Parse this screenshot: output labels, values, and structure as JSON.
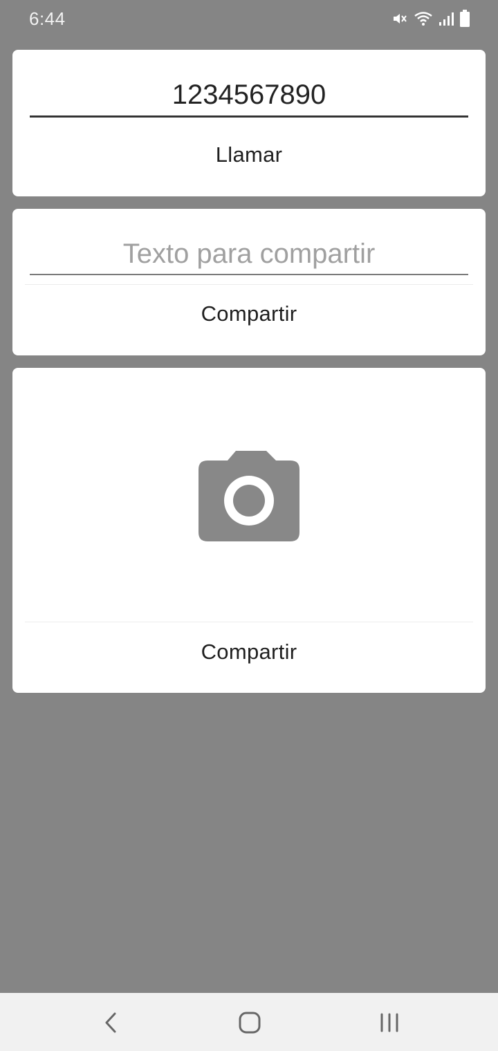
{
  "status_bar": {
    "time": "6:44",
    "icons": [
      "mute-icon",
      "wifi-icon",
      "signal-icon",
      "battery-icon"
    ]
  },
  "call_card": {
    "phone_value": "1234567890",
    "call_label": "Llamar"
  },
  "share_text_card": {
    "placeholder": "Texto para compartir",
    "share_label": "Compartir"
  },
  "share_image_card": {
    "image_icon": "camera-icon",
    "share_label": "Compartir"
  },
  "nav_bar": {
    "buttons": [
      "back-icon",
      "home-icon",
      "recents-icon"
    ]
  },
  "colors": {
    "background": "#858585",
    "card": "#ffffff",
    "icon_gray": "#888888",
    "nav_bar": "#f1f1f1"
  }
}
